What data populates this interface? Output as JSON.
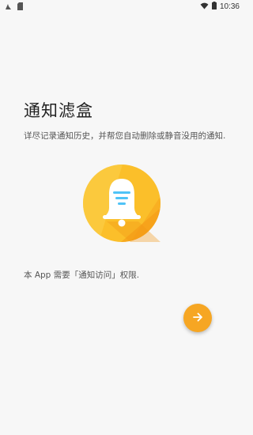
{
  "status_bar": {
    "time": "10:36",
    "left_icons": [
      "image-icon",
      "sd-card-icon"
    ],
    "right_icons": [
      "wifi-icon",
      "battery-icon"
    ]
  },
  "onboarding": {
    "title": "通知滤盒",
    "description": "详尽记录通知历史，并帮您自动删除或静音没用的通知.",
    "hero_icon": "bell-filter-icon",
    "permission_note": "本 App 需要「通知访问」权限."
  },
  "next_button": {
    "icon": "arrow-right-icon",
    "color": "#f6a623"
  },
  "colors": {
    "accent": "#f6a623",
    "hero_circle": "#fbbf2a",
    "filter_lines": "#4fc3f7"
  }
}
